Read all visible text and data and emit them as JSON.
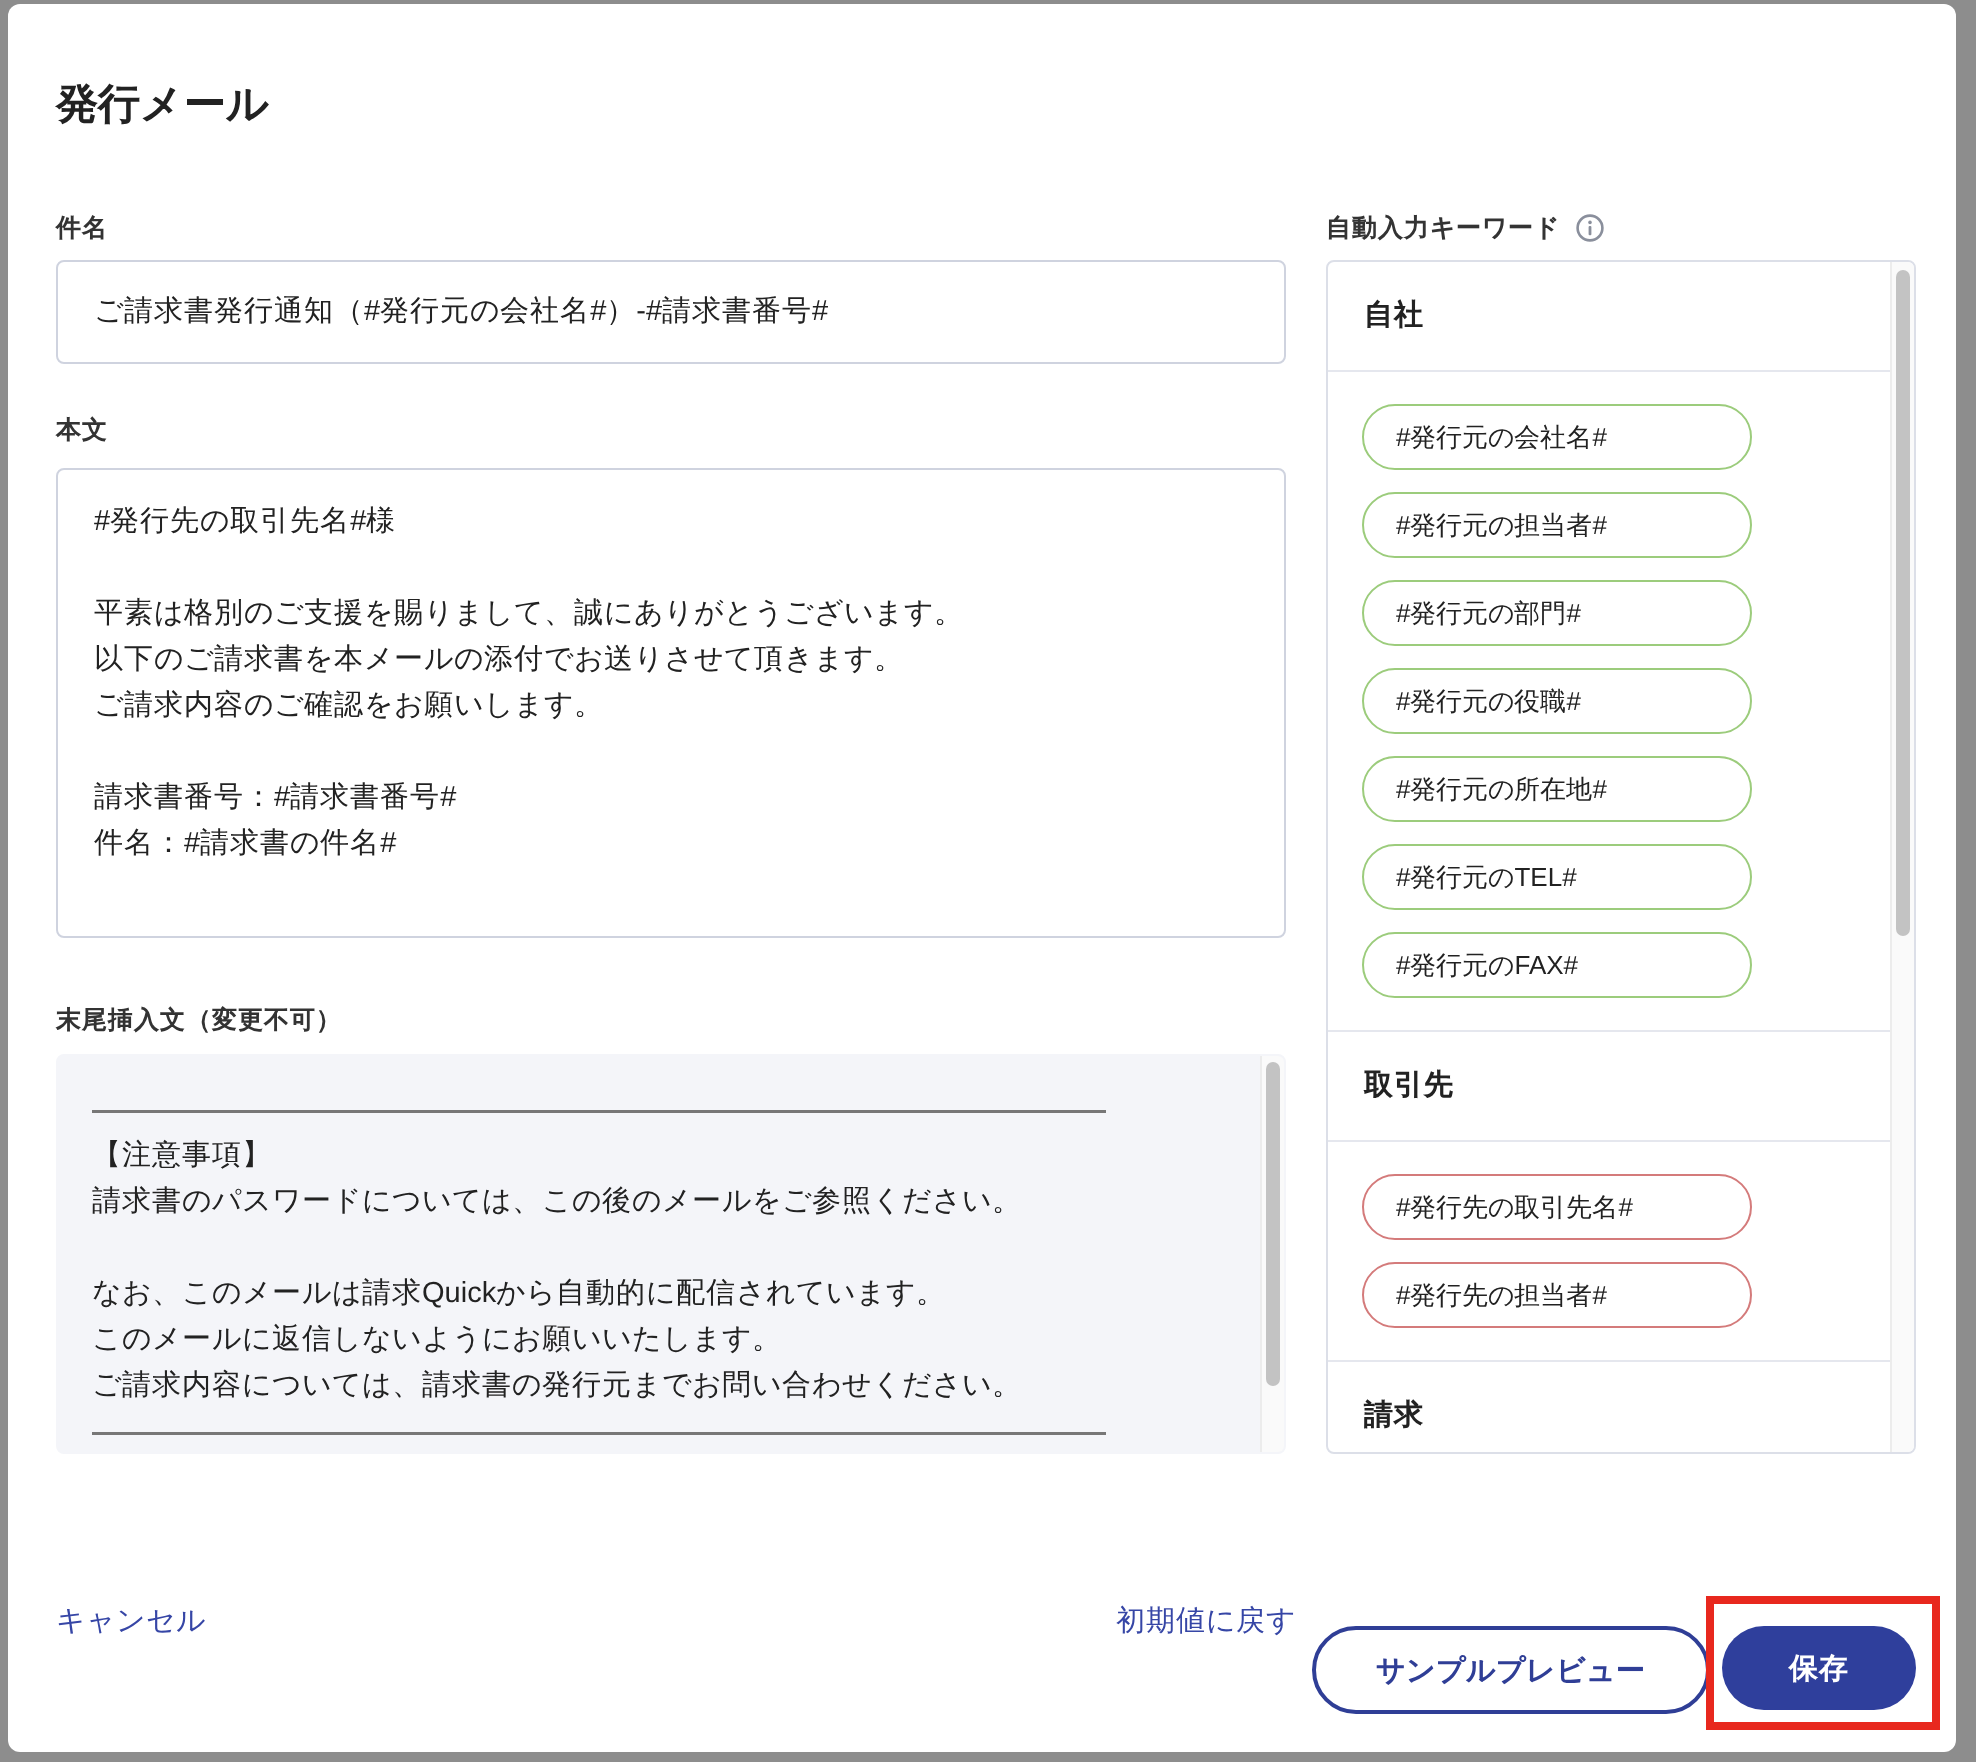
{
  "dialog": {
    "title": "発行メール"
  },
  "subject": {
    "label": "件名",
    "value": "ご請求書発行通知（#発行元の会社名#）-#請求書番号#"
  },
  "body": {
    "label": "本文",
    "lines": [
      {
        "kind": "text",
        "text": "#発行先の取引先名#様"
      },
      {
        "kind": "blank"
      },
      {
        "kind": "text",
        "text": "平素は格別のご支援を賜りまして、誠にありがとうございます。"
      },
      {
        "kind": "text",
        "text": "以下のご請求書を本メールの添付でお送りさせて頂きます。"
      },
      {
        "kind": "text",
        "text": "ご請求内容のご確認をお願いします。"
      },
      {
        "kind": "blank"
      },
      {
        "kind": "text",
        "text": "請求書番号：#請求書番号#"
      },
      {
        "kind": "text",
        "text": "件名：#請求書の件名#"
      }
    ]
  },
  "closing_text": {
    "label": "末尾挿入文（変更不可）",
    "disabled": true,
    "lines": [
      {
        "kind": "rule"
      },
      {
        "kind": "text",
        "text": "【注意事項】"
      },
      {
        "kind": "text",
        "text": "請求書のパスワードについては、この後のメールをご参照ください。"
      },
      {
        "kind": "blank"
      },
      {
        "kind": "text",
        "text": "なお、このメールは請求Quickから自動的に配信されています。"
      },
      {
        "kind": "text",
        "text": "このメールに返信しないようにお願いいたします。"
      },
      {
        "kind": "text",
        "text": "ご請求内容については、請求書の発行元までお問い合わせください。"
      },
      {
        "kind": "rule"
      }
    ]
  },
  "keywords": {
    "label": "自動入力キーワード",
    "groups": [
      {
        "title": "自社",
        "color": "#9ccc7c",
        "items": [
          "#発行元の会社名#",
          "#発行元の担当者#",
          "#発行元の部門#",
          "#発行元の役職#",
          "#発行元の所在地#",
          "#発行元のTEL#",
          "#発行元のFAX#"
        ]
      },
      {
        "title": "取引先",
        "color": "#d47b7b",
        "items": [
          "#発行先の取引先名#",
          "#発行先の担当者#"
        ]
      },
      {
        "title": "請求"
      }
    ]
  },
  "actions": [
    {
      "kind": "link",
      "label": "キャンセル",
      "highlighted": false
    },
    {
      "kind": "link",
      "label": "初期値に戻す",
      "highlighted": false
    },
    {
      "kind": "outline",
      "label": "サンプルプレビュー",
      "highlighted": false
    },
    {
      "kind": "primary",
      "label": "保存",
      "highlighted": true
    }
  ]
}
